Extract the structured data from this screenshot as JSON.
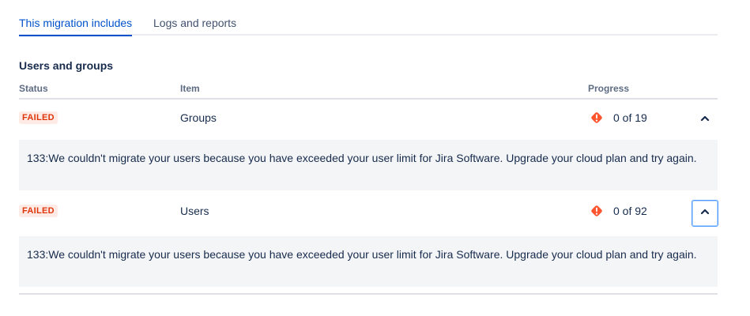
{
  "tabs": [
    {
      "label": "This migration includes",
      "active": true
    },
    {
      "label": "Logs and reports",
      "active": false
    }
  ],
  "section": {
    "title": "Users and groups"
  },
  "table": {
    "headers": {
      "status": "Status",
      "item": "Item",
      "progress": "Progress"
    },
    "rows": [
      {
        "status": "FAILED",
        "item": "Groups",
        "progress_text": "0 of 19",
        "progress_icon": "warning-icon",
        "toggle_icon": "chevron-up-icon",
        "error": "133:We couldn't migrate your users because you have exceeded your user limit for Jira Software. Upgrade your cloud plan and try again."
      },
      {
        "status": "FAILED",
        "item": "Users",
        "progress_text": "0 of 92",
        "progress_icon": "warning-icon",
        "toggle_icon": "chevron-up-icon",
        "error": "133:We couldn't migrate your users because you have exceeded your user limit for Jira Software. Upgrade your cloud plan and try again."
      }
    ]
  },
  "colors": {
    "accent": "#0052cc",
    "failed_text": "#de350b",
    "failed_bg": "#ffebe6",
    "warning_icon": "#ff5630",
    "detail_bg": "#f4f5f7"
  }
}
